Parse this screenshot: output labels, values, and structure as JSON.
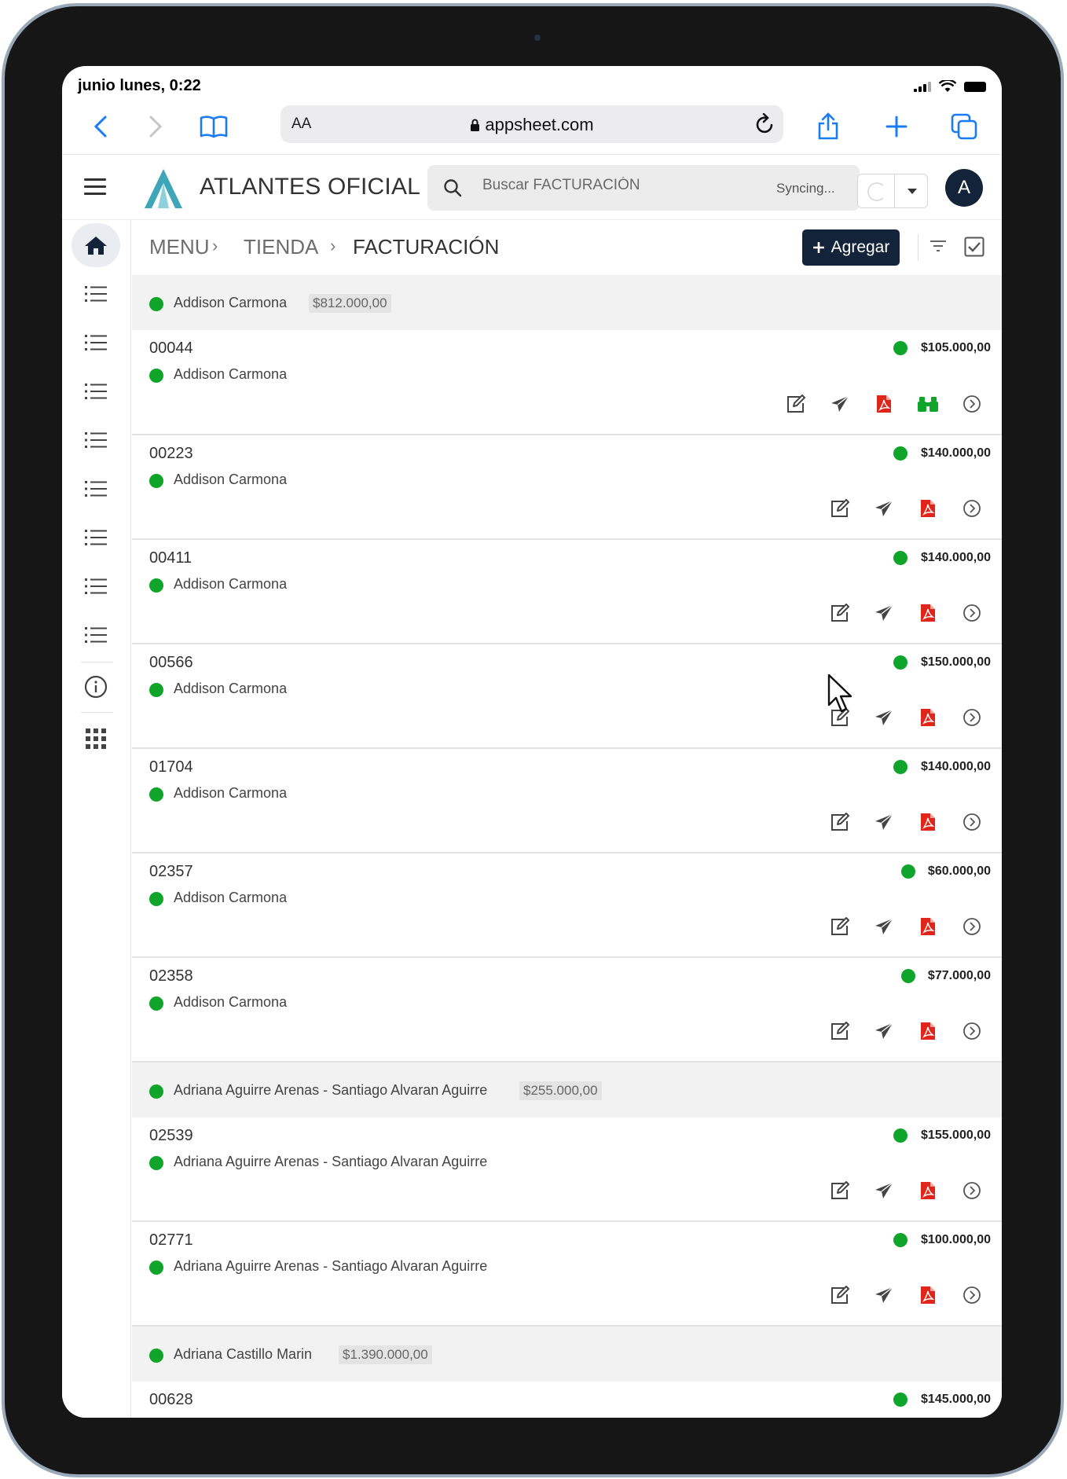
{
  "status": {
    "time": "junio lunes, 0:22"
  },
  "browser": {
    "text_size_label": "AA",
    "url": "appsheet.com"
  },
  "app": {
    "title": "ATLANTES OFICIAL",
    "search_placeholder": "Buscar FACTURACIÓN",
    "sync_status": "Syncing...",
    "avatar_initial": "A",
    "brand_color": "#13233a",
    "status_color": "#0ea52a"
  },
  "breadcrumb": [
    "MENU",
    "TIENDA",
    "FACTURACIÓN"
  ],
  "toolbar": {
    "add_label": "Agregar"
  },
  "groups": [
    {
      "name": "Addison Carmona",
      "total": "$812.000,00"
    },
    {
      "name": "Adriana Aguirre Arenas - Santiago Alvaran Aguirre",
      "total": "$255.000,00"
    },
    {
      "name": "Adriana Castillo Marin",
      "total": "$1.390.000,00"
    }
  ],
  "rows": [
    {
      "number": "00044",
      "client": "Addison Carmona",
      "amount": "$105.000,00"
    },
    {
      "number": "00223",
      "client": "Addison Carmona",
      "amount": "$140.000,00"
    },
    {
      "number": "00411",
      "client": "Addison Carmona",
      "amount": "$140.000,00"
    },
    {
      "number": "00566",
      "client": "Addison Carmona",
      "amount": "$150.000,00"
    },
    {
      "number": "01704",
      "client": "Addison Carmona",
      "amount": "$140.000,00"
    },
    {
      "number": "02357",
      "client": "Addison Carmona",
      "amount": "$60.000,00"
    },
    {
      "number": "02358",
      "client": "Addison Carmona",
      "amount": "$77.000,00"
    },
    {
      "number": "02539",
      "client": "Adriana Aguirre Arenas - Santiago Alvaran Aguirre",
      "amount": "$155.000,00"
    },
    {
      "number": "02771",
      "client": "Adriana Aguirre Arenas - Santiago Alvaran Aguirre",
      "amount": "$100.000,00"
    },
    {
      "number": "00628",
      "client": "",
      "amount": "$145.000,00"
    }
  ]
}
